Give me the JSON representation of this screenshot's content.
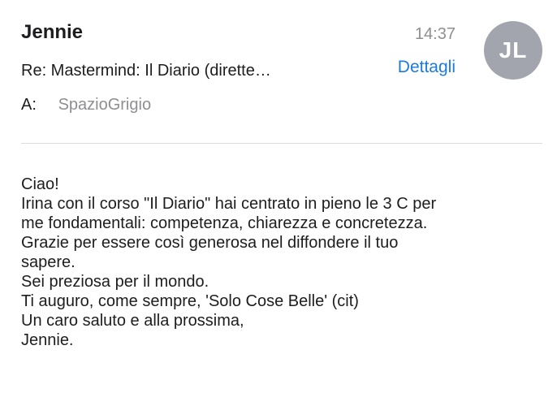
{
  "header": {
    "sender": "Jennie",
    "time": "14:37",
    "avatar_initials": "JL",
    "subject": "Re: Mastermind: Il Diario (dirette…",
    "details_label": "Dettagli",
    "to_label": "A:",
    "to_value": "SpazioGrigio"
  },
  "body": {
    "lines": [
      "Ciao!",
      "Irina con il corso \"Il Diario\" hai centrato in pieno le 3 C per",
      "me fondamentali: competenza, chiarezza e concretezza.",
      "Grazie per essere così generosa nel diffondere il tuo",
      "sapere.",
      "Sei preziosa per il mondo.",
      "Ti auguro, come sempre, 'Solo Cose Belle' (cit)",
      "Un caro saluto e alla prossima,",
      "Jennie."
    ]
  },
  "colors": {
    "accent": "#1a7be0",
    "avatar_bg": "#a2a5ad",
    "secondary_text": "#8e8e93"
  }
}
